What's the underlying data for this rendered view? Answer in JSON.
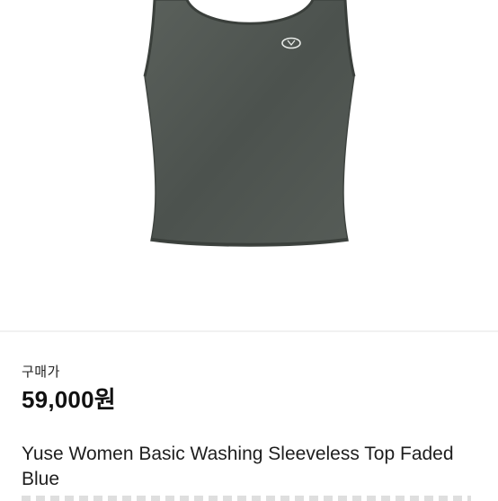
{
  "product": {
    "image_icon": "sleeveless-top-image",
    "logo_icon": "brand-logo-badge",
    "price_label": "구매가",
    "price": "59,000원",
    "title": "Yuse Women Basic Washing Sleeveless Top Faded Blue"
  },
  "colors": {
    "garment": "#4f5550",
    "background": "#ffffff",
    "divider": "#f1f1f1"
  }
}
